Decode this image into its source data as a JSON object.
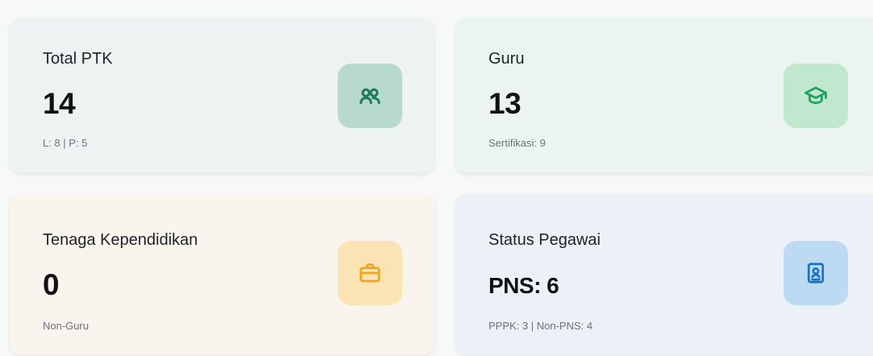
{
  "cards": [
    {
      "title": "Total PTK",
      "value": "14",
      "sub": "L: 8 | P: 5",
      "icon": "users-icon",
      "accent": "#1e7a5a"
    },
    {
      "title": "Guru",
      "value": "13",
      "sub": "Sertifikasi: 9",
      "icon": "graduation-cap-icon",
      "accent": "#1fa35a"
    },
    {
      "title": "Tenaga Kependidikan",
      "value": "0",
      "sub": "Non-Guru",
      "icon": "briefcase-icon",
      "accent": "#f0a61a"
    },
    {
      "title": "Status Pegawai",
      "value": "PNS: 6",
      "sub": "PPPK: 3 | Non-PNS: 4",
      "icon": "id-card-icon",
      "accent": "#1c73c4"
    }
  ]
}
